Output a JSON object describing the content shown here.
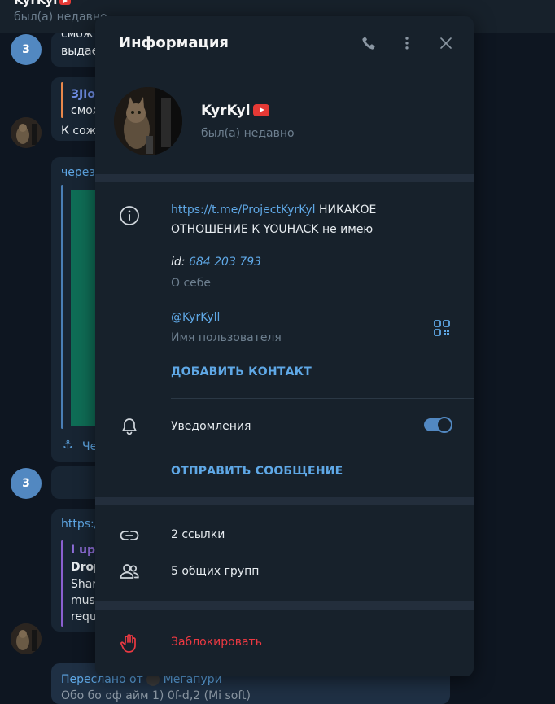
{
  "background_chat": {
    "name": "KyrKyl",
    "status": "был(а) недавно",
    "unread_avatar_1": "3",
    "unread_avatar_2": "3",
    "msg1_line1": "смож",
    "msg1_line2": "выдае",
    "reply_name": "ЗJIoo",
    "reply_text": "смож",
    "msg2_text": "К сож",
    "msg3_text": "через",
    "msg3_footer": "Че",
    "msg4_link": "https:/",
    "msg4_quote_title": "I upl",
    "msg4_quote_bold": "Drop",
    "msg4_quote_l1": "Shar",
    "msg4_quote_l2": "mus",
    "msg4_quote_l3": "requ",
    "forwarded": "Переслано от",
    "forwarded_from": "Мегапури",
    "bottom_partial": "Обо бо оф айм 1) 0f-d,2 (Мi  soft)"
  },
  "panel": {
    "title": "Информация",
    "name": "KyrKyl",
    "status": "был(а) недавно",
    "bio_link": "https://t.me/ProjectKyrKyl",
    "bio_text": " НИКАКОЕ ОТНОШЕНИЕ К YOUHACK не имею",
    "id_label": "id: ",
    "id_value": "684 203 793",
    "about_label": "О себе",
    "username": "@KyrKyll",
    "username_label": "Имя пользователя",
    "add_contact": "ДОБАВИТЬ КОНТАКТ",
    "notifications_label": "Уведомления",
    "notifications_on": true,
    "send_message": "ОТПРАВИТЬ СООБЩЕНИЕ",
    "links": "2 ссылки",
    "groups": "5 общих групп",
    "block": "Заблокировать"
  },
  "icons": [
    "phone-icon",
    "more-vertical-icon",
    "close-icon",
    "info-icon",
    "qr-code-icon",
    "bell-icon",
    "link-icon",
    "users-icon",
    "hand-block-icon",
    "youtube-icon"
  ],
  "colors": {
    "accent": "#5fa8e6",
    "toggle": "#5288c1",
    "danger": "#ec3942",
    "panel_bg": "#17212b",
    "app_bg": "#0e1621"
  }
}
